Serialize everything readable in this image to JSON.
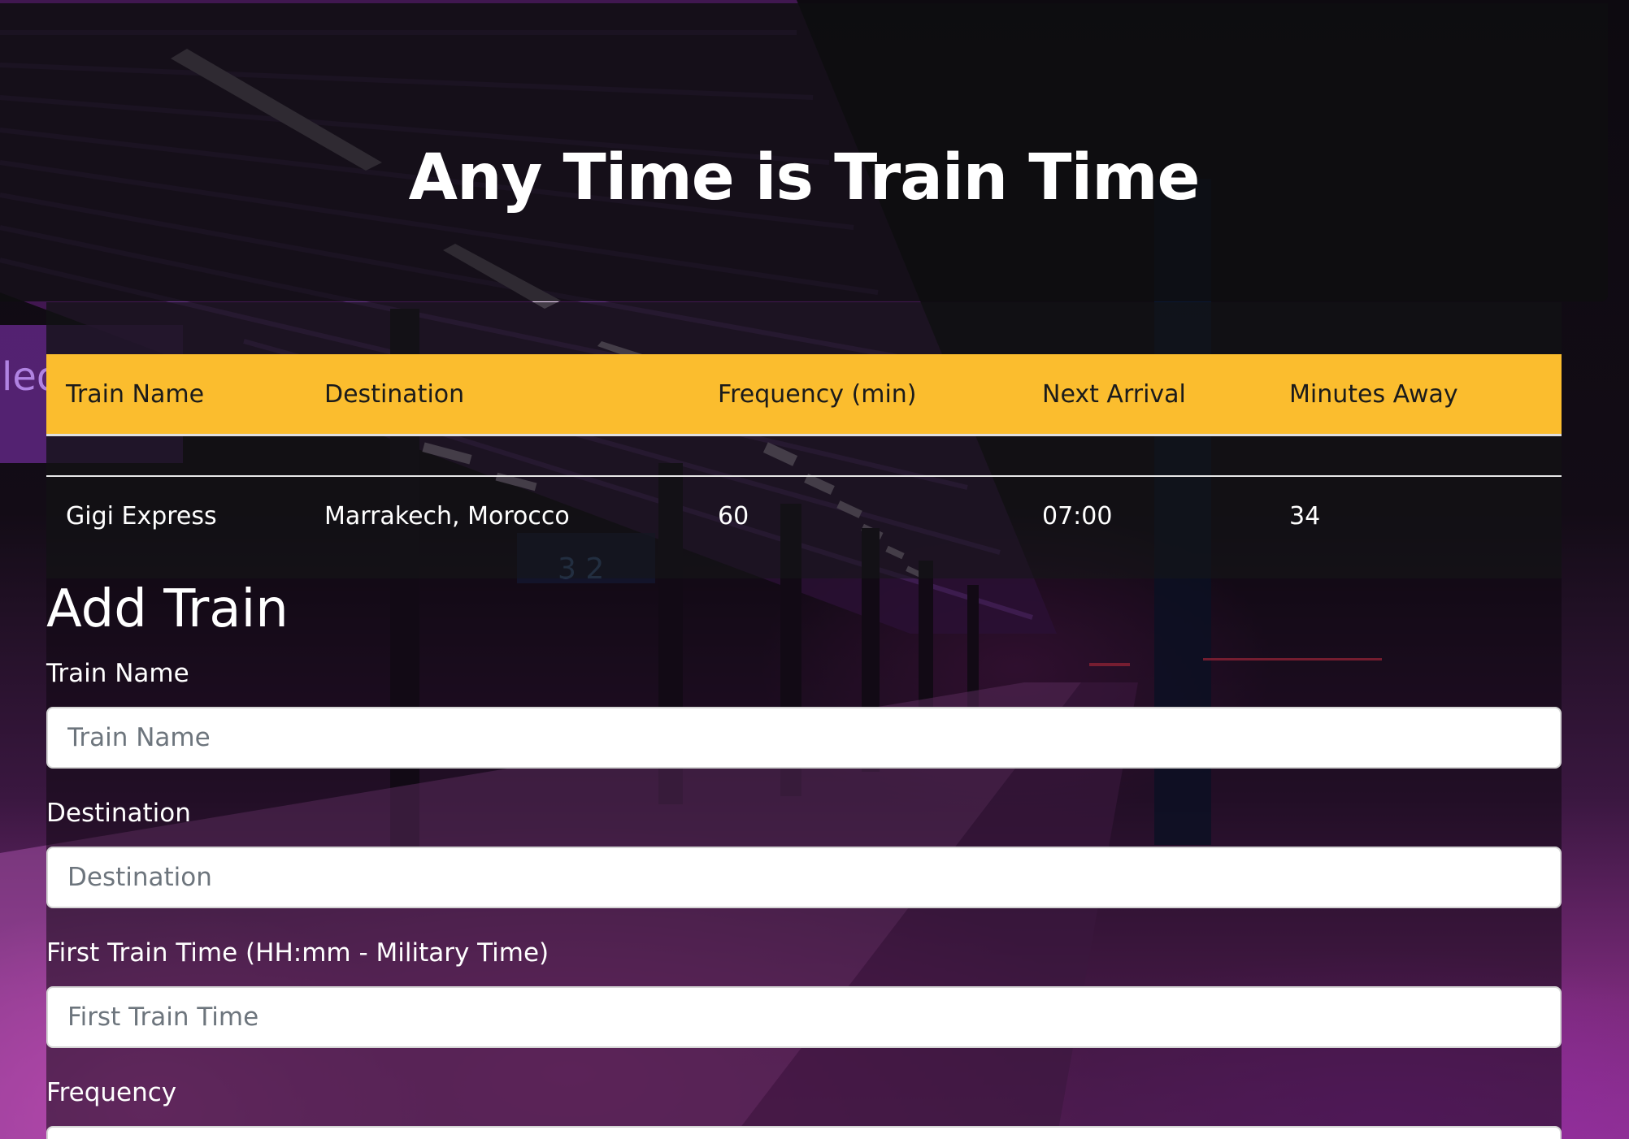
{
  "page": {
    "title": "Any Time is Train Time"
  },
  "table": {
    "headers": [
      "Train Name",
      "Destination",
      "Frequency (min)",
      "Next Arrival",
      "Minutes Away"
    ],
    "rows": [
      {
        "name": "Gigi Express",
        "destination": "Marrakech, Morocco",
        "frequency": "60",
        "next_arrival": "07:00",
        "minutes_away": "34"
      }
    ]
  },
  "form": {
    "title": "Add Train",
    "fields": [
      {
        "label": "Train Name",
        "placeholder": "Train Name"
      },
      {
        "label": "Destination",
        "placeholder": "Destination"
      },
      {
        "label": "First Train Time (HH:mm - Military Time)",
        "placeholder": "First Train Time"
      },
      {
        "label": "Frequency",
        "placeholder": ""
      }
    ]
  },
  "colors": {
    "table_header": "#fbbd2e",
    "background_accent": "#c030aa"
  }
}
